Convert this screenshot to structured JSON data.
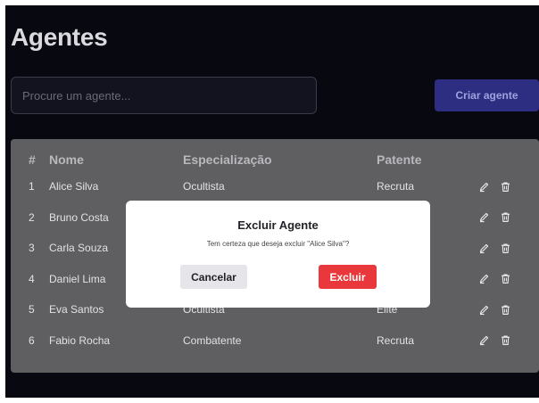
{
  "page": {
    "title": "Agentes"
  },
  "search": {
    "placeholder": "Procure um agente..."
  },
  "toolbar": {
    "create_label": "Criar agente"
  },
  "table": {
    "headers": {
      "num": "#",
      "name": "Nome",
      "spec": "Especialização",
      "rank": "Patente"
    },
    "rows": [
      {
        "num": "1",
        "name": "Alice Silva",
        "spec": "Ocultista",
        "rank": "Recruta"
      },
      {
        "num": "2",
        "name": "Bruno Costa",
        "spec": "",
        "rank": ""
      },
      {
        "num": "3",
        "name": "Carla Souza",
        "spec": "",
        "rank": ""
      },
      {
        "num": "4",
        "name": "Daniel Lima",
        "spec": "",
        "rank": ""
      },
      {
        "num": "5",
        "name": "Eva Santos",
        "spec": "Ocultista",
        "rank": "Elite"
      },
      {
        "num": "6",
        "name": "Fabio Rocha",
        "spec": "Combatente",
        "rank": "Recruta"
      }
    ],
    "row_icons": {
      "edit": "pencil-icon",
      "delete": "trash-icon"
    }
  },
  "modal": {
    "title": "Excluir Agente",
    "message": "Tem certeza que deseja excluir \"Alice Silva\"?",
    "cancel_label": "Cancelar",
    "confirm_label": "Excluir"
  },
  "colors": {
    "background": "#080810",
    "table_bg": "#5f5f62",
    "accent": "#2d2d82",
    "danger": "#e8383b"
  }
}
